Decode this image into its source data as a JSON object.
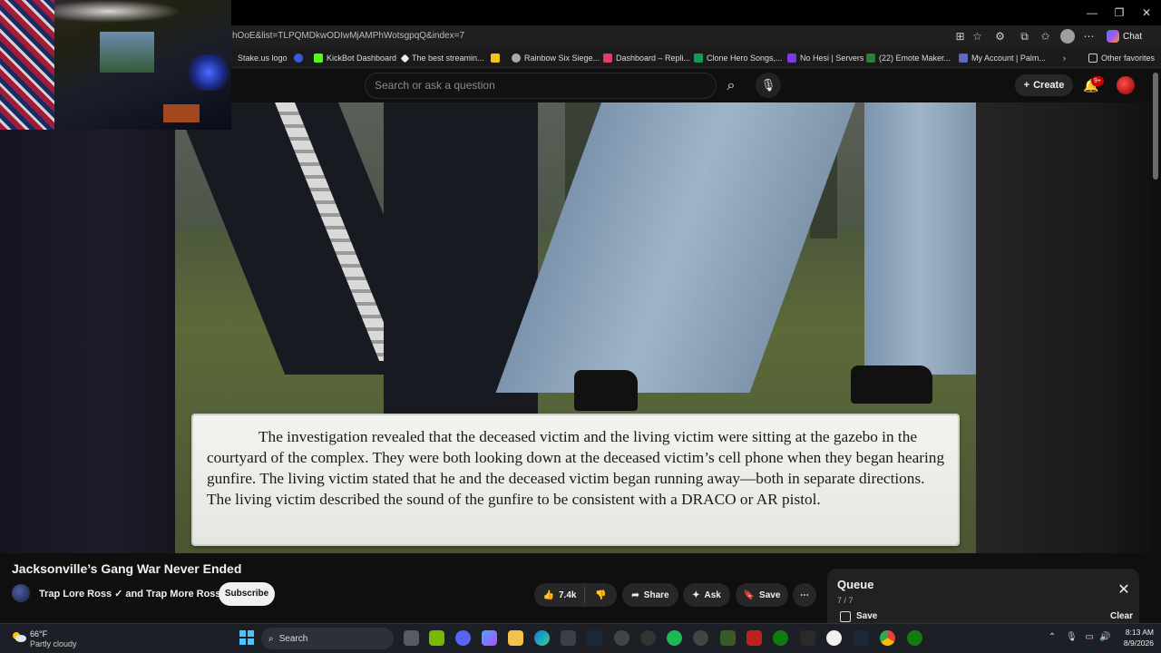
{
  "browser": {
    "url": "hOoE&list=TLPQMDkwODIwMjAMPhWotsgpqQ&index=7",
    "chat_label": "Chat",
    "bookmarks": [
      {
        "label": "Stake.us logo",
        "color": "#1a2c38"
      },
      {
        "label": "",
        "color": "#3b5bdb"
      },
      {
        "label": "KickBot Dashboard",
        "color": "#53fc18"
      },
      {
        "label": "The best streamin...",
        "color": "#eeeeee"
      },
      {
        "label": "",
        "color": "#f5c518"
      },
      {
        "label": "Rainbow Six Siege...",
        "color": "#aaaaaa"
      },
      {
        "label": "Dashboard – Repli...",
        "color": "#e23d64"
      },
      {
        "label": "Clone Hero Songs,...",
        "color": "#0f9d58"
      },
      {
        "label": "No Hesi | Servers",
        "color": "#7c3aed"
      },
      {
        "label": "(22) Emote Maker...",
        "color": "#2e7d32"
      },
      {
        "label": "My Account | Palm...",
        "color": "#5c6bc0"
      }
    ],
    "other_favorites": "Other favorites"
  },
  "youtube": {
    "search_placeholder": "Search or ask a question",
    "create_label": "Create",
    "notifications_badge": "9+"
  },
  "video": {
    "caption": "The investigation revealed that the deceased victim and the living victim were sitting at the gazebo in the courtyard of the complex. They were both looking down at the deceased victim’s cell phone when they began hearing gunfire. The living victim stated that he and the deceased victim began running away—both in separate directions. The living victim described the sound of the gunfire to be consistent with a DRACO or AR pistol.",
    "title": "Jacksonville’s Gang War Never Ended",
    "channel": "Trap Lore Ross ✓ and Trap More Ross",
    "subscribe_label": "Subscribe",
    "likes": "7.4k",
    "share_label": "Share",
    "ask_label": "Ask",
    "save_label": "Save"
  },
  "queue": {
    "title": "Queue",
    "count": "7 / 7",
    "save_label": "Save",
    "clear_label": "Clear"
  },
  "taskbar": {
    "temp": "66°F",
    "weather": "Partly cloudy",
    "search_label": "Search",
    "time": "8:13 AM",
    "date": "8/9/2026"
  }
}
